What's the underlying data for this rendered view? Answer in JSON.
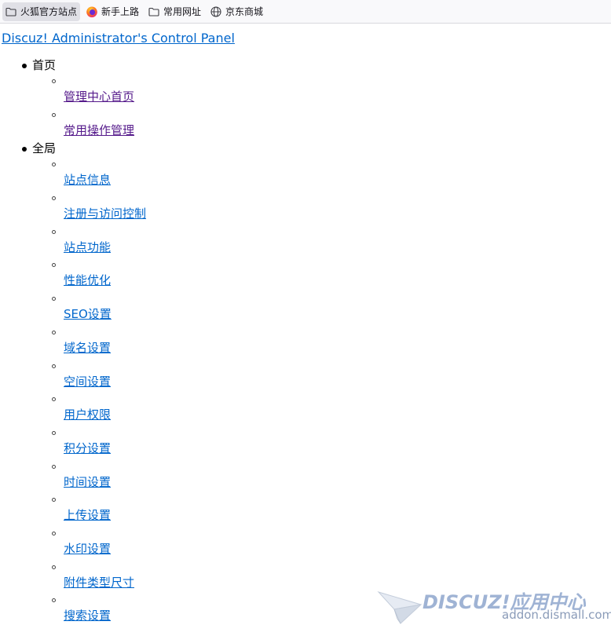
{
  "bookmarks": [
    {
      "label": "火狐官方站点",
      "icon": "folder-icon",
      "active": true
    },
    {
      "label": "新手上路",
      "icon": "firefox-icon",
      "active": false
    },
    {
      "label": "常用网址",
      "icon": "folder-icon",
      "active": false
    },
    {
      "label": "京东商城",
      "icon": "globe-icon",
      "active": false
    }
  ],
  "page": {
    "title_link": "Discuz! Administrator's Control Panel"
  },
  "menu": [
    {
      "label": "首页",
      "items": [
        {
          "label": "管理中心首页",
          "visited": true
        },
        {
          "label": "常用操作管理",
          "visited": true
        }
      ]
    },
    {
      "label": "全局",
      "items": [
        {
          "label": "站点信息",
          "visited": false
        },
        {
          "label": "注册与访问控制",
          "visited": false
        },
        {
          "label": "站点功能",
          "visited": false
        },
        {
          "label": "性能优化",
          "visited": false
        },
        {
          "label": "SEO设置",
          "visited": false
        },
        {
          "label": "域名设置",
          "visited": false
        },
        {
          "label": "空间设置",
          "visited": false
        },
        {
          "label": "用户权限",
          "visited": false
        },
        {
          "label": "积分设置",
          "visited": false
        },
        {
          "label": "时间设置",
          "visited": false
        },
        {
          "label": "上传设置",
          "visited": false
        },
        {
          "label": "水印设置",
          "visited": false
        },
        {
          "label": "附件类型尺寸",
          "visited": false
        },
        {
          "label": "搜索设置",
          "visited": false
        }
      ]
    }
  ],
  "watermark": {
    "brand": "DISCUZ!应用中心",
    "domain": "addon.dismall.com"
  },
  "colors": {
    "link": "#0066cc",
    "visited": "#551a8b",
    "watermark": "#9fb3d4"
  }
}
